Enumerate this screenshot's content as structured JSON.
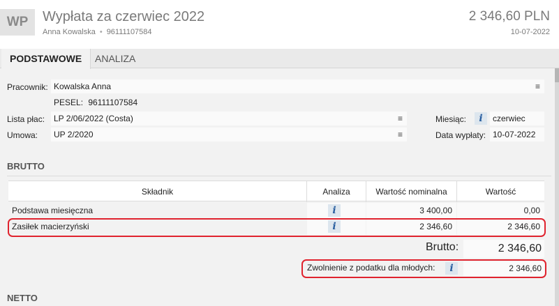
{
  "header": {
    "avatar": "WP",
    "title": "Wypłata za czerwiec 2022",
    "employee": "Anna Kowalska",
    "pesel": "96111107584",
    "amount": "2 346,60 PLN",
    "date": "10-07-2022"
  },
  "tabs": [
    {
      "label": "PODSTAWOWE",
      "active": true
    },
    {
      "label": "ANALIZA",
      "active": false
    }
  ],
  "form": {
    "pracownik_label": "Pracownik:",
    "pracownik_value": "Kowalska Anna",
    "pesel_label": "PESEL:",
    "pesel_value": "96111107584",
    "lista_label": "Lista płac:",
    "lista_value": "LP 2/06/2022 (Costa)",
    "umowa_label": "Umowa:",
    "umowa_value": "UP 2/2020",
    "miesiac_label": "Miesiąc:",
    "miesiac_value": "czerwiec 2022",
    "data_wyplaty_label": "Data wypłaty:",
    "data_wyplaty_value": "10-07-2022",
    "menu_glyph": "≡",
    "info_glyph": "i"
  },
  "brutto": {
    "section_title": "BRUTTO",
    "columns": [
      "Składnik",
      "Analiza",
      "Wartość nominalna",
      "Wartość"
    ],
    "rows": [
      {
        "skladnik": "Podstawa miesięczna",
        "nominalna": "3 400,00",
        "wartosc": "0,00",
        "highlighted": false
      },
      {
        "skladnik": "Zasiłek macierzyński",
        "nominalna": "2 346,60",
        "wartosc": "2 346,60",
        "highlighted": true
      }
    ],
    "total_label": "Brutto:",
    "total_value": "2 346,60",
    "zwolnienie_label": "Zwolnienie z podatku dla młodych:",
    "zwolnienie_value": "2 346,60"
  },
  "netto": {
    "section_title": "NETTO"
  },
  "colors": {
    "highlight": "#e0232e",
    "info_icon": "#2a5fa0"
  }
}
